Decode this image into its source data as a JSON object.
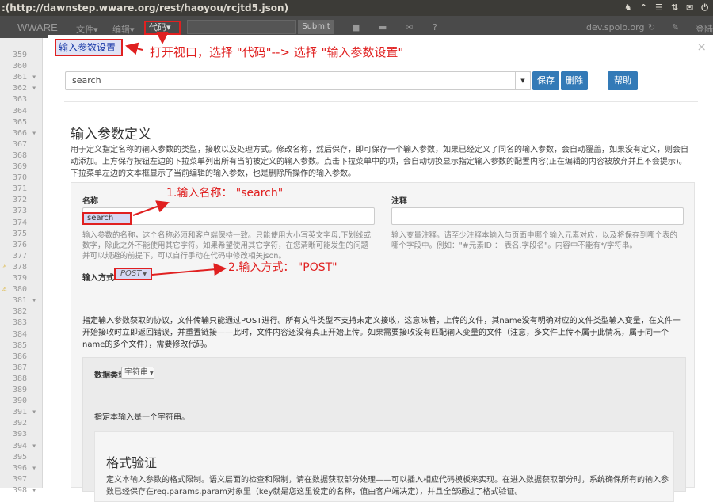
{
  "window": {
    "title": ":(http://dawnstep.wware.org/rest/haoyou/rcjtd5.json)",
    "tray": [
      "♞",
      "⌃",
      "☰",
      "⇅",
      "✉",
      "⏻"
    ]
  },
  "appbar": {
    "brand": "WWARE",
    "menu_file": "文件▾",
    "menu_edit": "编辑▾",
    "menu_code": "代码▾",
    "submit": "Submit",
    "domain": "dev.spolo.org",
    "login": "登陆"
  },
  "gutter": {
    "lines": [
      "359",
      "360",
      "361 ▾",
      "362 ▾",
      "363",
      "364",
      "365",
      "366 ▾",
      "367",
      "368",
      "369",
      "370",
      "371",
      "372",
      "373",
      "374",
      "375",
      "376",
      "377",
      "378",
      "379",
      "380",
      "381 ▾",
      "382",
      "383",
      "384",
      "385",
      "386",
      "387",
      "388",
      "389",
      "390",
      "391 ▾",
      "392",
      "393",
      "394 ▾",
      "395",
      "396 ▾",
      "397",
      "398 ▾"
    ],
    "warn_lines": [
      "378",
      "380"
    ]
  },
  "modal": {
    "selected_menu_item": "输入参数设置",
    "callout_top": "打开视口，选择 \"代码\"--> 选择 \"输入参数设置\"",
    "combo_value": "search",
    "save_button": "保存",
    "delete_button": "删除",
    "help_button": "帮助",
    "section_title": "输入参数定义",
    "section_desc": "用于定义指定名称的输入参数的类型，接收以及处理方式。修改名称，然后保存，即可保存一个输入参数，如果已经定义了同名的输入参数，会自动覆盖，如果没有定义，则会自动添加。上方保存按钮左边的下拉菜单列出所有当前被定义的输入参数。点击下拉菜单中的项，会自动切换显示指定输入参数的配置内容(正在编辑的内容被放弃并且不会提示)。下拉菜单左边的文本框显示了当前编辑的输入参数，也是删除所操作的输入参数。",
    "name_label": "名称",
    "name_value": "search",
    "callout_name": "1.输入名称：  \"search\"",
    "name_help": "输入参数的名称，这个名称必须和客户端保持一致。只能使用大小写英文字母,下划线或数字，除此之外不能使用其它字符。如果希望使用其它字符，在您清晰可能发生的问题并可以规避的前提下，可以自行手动在代码中修改相关json。",
    "comment_label": "注释",
    "comment_help": "输入变量注释。请至少注释本输入与页面中哪个输入元素对应，以及将保存到哪个表的哪个字段中。例如：\"#元素ID ： 表名.字段名\"。内容中不能有*/字符串。",
    "method_label": "输入方式",
    "method_value": "POST",
    "callout_method": "2.输入方式：  \"POST\"",
    "method_desc": "指定输入参数获取的协议，文件传输只能通过POST进行。所有文件类型不支持未定义接收，这意味着，上传的文件，其name没有明确对应的文件类型输入变量，在文件一开始接收时立即返回错误，并重置链接——此时，文件内容还没有真正开始上传。如果需要接收没有匹配输入变量的文件（注意，多文件上传不属于此情况，属于同一个name的多个文件），需要修改代码。",
    "dtype_label": "数据类型",
    "dtype_value": "字符串",
    "dtype_desc": "指定本输入是一个字符串。",
    "format_title": "格式验证",
    "format_desc": "定义本输入参数的格式限制。语义层面的检查和限制，请在数据获取部分处理——可以插入相应代码模板来实现。在进入数据获取部分时，系统确保所有的输入参数已经保存在req.params.param对象里（key就是您这里设定的名称，值由客户端决定），并且全部通过了格式验证。"
  },
  "colors": {
    "annotation_red": "#e02020",
    "button_blue": "#337ab7",
    "titlebar": "#3c3b37"
  }
}
